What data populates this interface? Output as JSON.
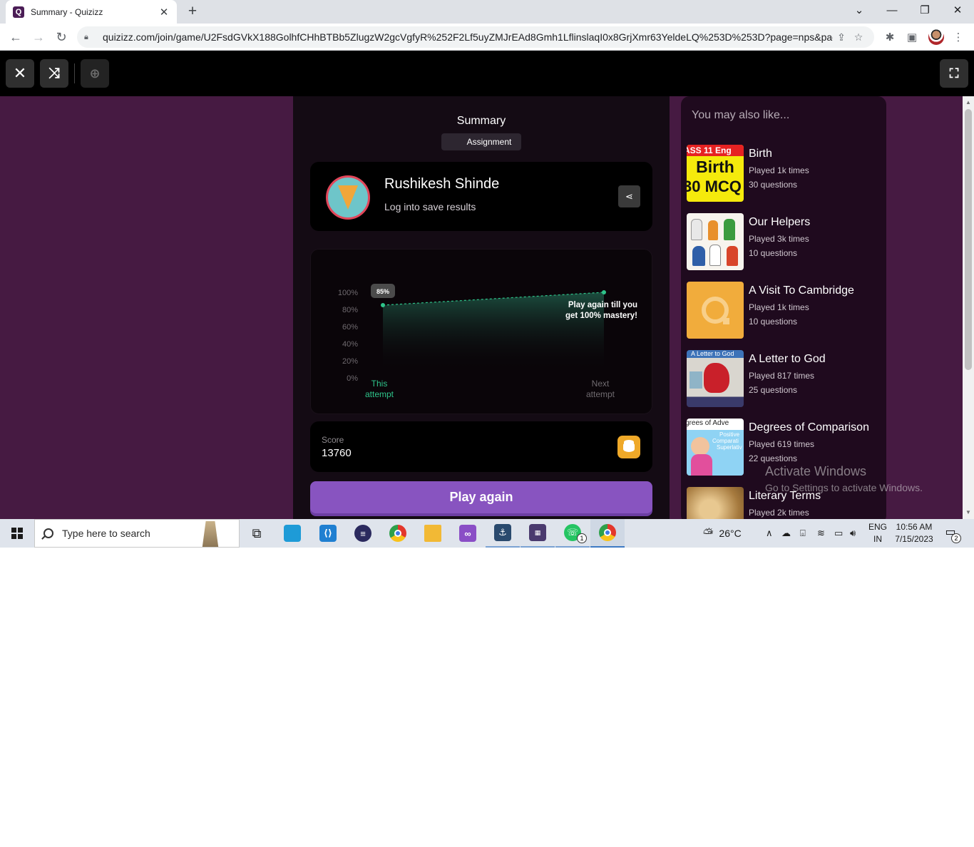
{
  "browser": {
    "tab_title": "Summary - Quizizz",
    "tab_favicon": "Q",
    "url": "quizizz.com/join/game/U2FsdGVkX188GolhfCHhBTBb5ZlugzW2gcVgfyR%252F2Lf5uyZMJrEAd8Gmh1LflinslaqI0x8GrjXmr63YeldeLQ%253D%253D?page=nps&pag...",
    "icons": [
      "back-icon",
      "forward-icon",
      "reload-icon",
      "lock-icon",
      "share-icon",
      "star-icon",
      "extensions-icon",
      "sidepanel-icon",
      "profile-avatar",
      "menu-icon"
    ]
  },
  "app_bar": {
    "icons": [
      "close-icon",
      "shuffle-icon",
      "zoom-icon",
      "fullscreen-icon"
    ]
  },
  "summary": {
    "title": "Summary",
    "mode_label": "Assignment",
    "user_name": "Rushikesh Shinde",
    "user_sub": "Log into save results",
    "score_label": "Score",
    "score_value": "13760",
    "play_again": "Play again"
  },
  "chart_data": {
    "type": "line",
    "categories": [
      "This attempt",
      "Next attempt"
    ],
    "category_lines": [
      [
        "This",
        "attempt"
      ],
      [
        "Next",
        "attempt"
      ]
    ],
    "values": [
      85,
      100
    ],
    "ylim": [
      0,
      100
    ],
    "y_ticks": [
      "100%",
      "80%",
      "60%",
      "40%",
      "20%",
      "0%"
    ],
    "point_label": "85%",
    "annotation": [
      "Play again till you",
      "get 100% mastery!"
    ],
    "line_color": "#2ec48a",
    "active_label_color": "#2ec48a",
    "inactive_label_color": "#6f6a6f"
  },
  "recommendations": {
    "heading": "You may also like...",
    "items": [
      {
        "title": "Birth",
        "plays": "Played 1k times",
        "questions": "30 questions",
        "thumb_text": [
          "ASS 11 Eng",
          "Birth",
          "30 MCQ"
        ]
      },
      {
        "title": "Our Helpers",
        "plays": "Played 3k times",
        "questions": "10 questions"
      },
      {
        "title": "A Visit To Cambridge",
        "plays": "Played 1k times",
        "questions": "10 questions"
      },
      {
        "title": "A Letter to God",
        "plays": "Played 817 times",
        "questions": "25 questions",
        "thumb_text": [
          "A Letter to God"
        ]
      },
      {
        "title": "Degrees of Comparison",
        "plays": "Played 619 times",
        "questions": "22 questions",
        "thumb_text": [
          "grees of Adve",
          "Positive",
          "Comparati",
          "Superlativ"
        ]
      },
      {
        "title": "Literary Terms",
        "plays": "Played 2k times",
        "questions": ""
      }
    ]
  },
  "watermark": {
    "line1": "Activate Windows",
    "line2": "Go to Settings to activate Windows."
  },
  "taskbar": {
    "search_placeholder": "Type here to search",
    "weather": "26°C",
    "lang_1": "ENG",
    "lang_2": "IN",
    "time": "10:56 AM",
    "date": "7/15/2023",
    "notification_count": "2",
    "whatsapp_badge": "1"
  }
}
